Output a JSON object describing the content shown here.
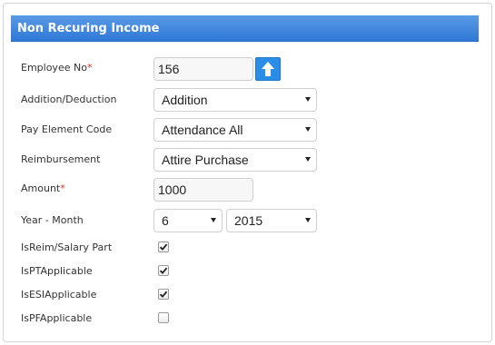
{
  "panel": {
    "title": "Non Recuring Income"
  },
  "form": {
    "employee_no": {
      "label": "Employee No",
      "required_mark": "*",
      "value": "156"
    },
    "addition_deduction": {
      "label": "Addition/Deduction",
      "value": "Addition"
    },
    "pay_element_code": {
      "label": "Pay Element Code",
      "value": "Attendance All"
    },
    "reimbursement": {
      "label": "Reimbursement",
      "value": "Attire Purchase"
    },
    "amount": {
      "label": "Amount",
      "required_mark": "*",
      "value": "1000"
    },
    "year_month": {
      "label": "Year - Month",
      "month_value": "6",
      "year_value": "2015"
    },
    "is_reim_salary_part": {
      "label": "IsReim/Salary Part",
      "checked": true
    },
    "is_pt_applicable": {
      "label": "IsPTApplicable",
      "checked": true
    },
    "is_esi_applicable": {
      "label": "IsESIApplicable",
      "checked": true
    },
    "is_pf_applicable": {
      "label": "IsPFApplicable",
      "checked": false
    }
  },
  "icons": {
    "lookup_button": "arrow-up-icon",
    "dropdown": "chevron-down-icon",
    "check": "check-icon"
  },
  "colors": {
    "header": "#2f78d6",
    "required": "#e0301e",
    "lookup_button": "#2a8de6"
  }
}
